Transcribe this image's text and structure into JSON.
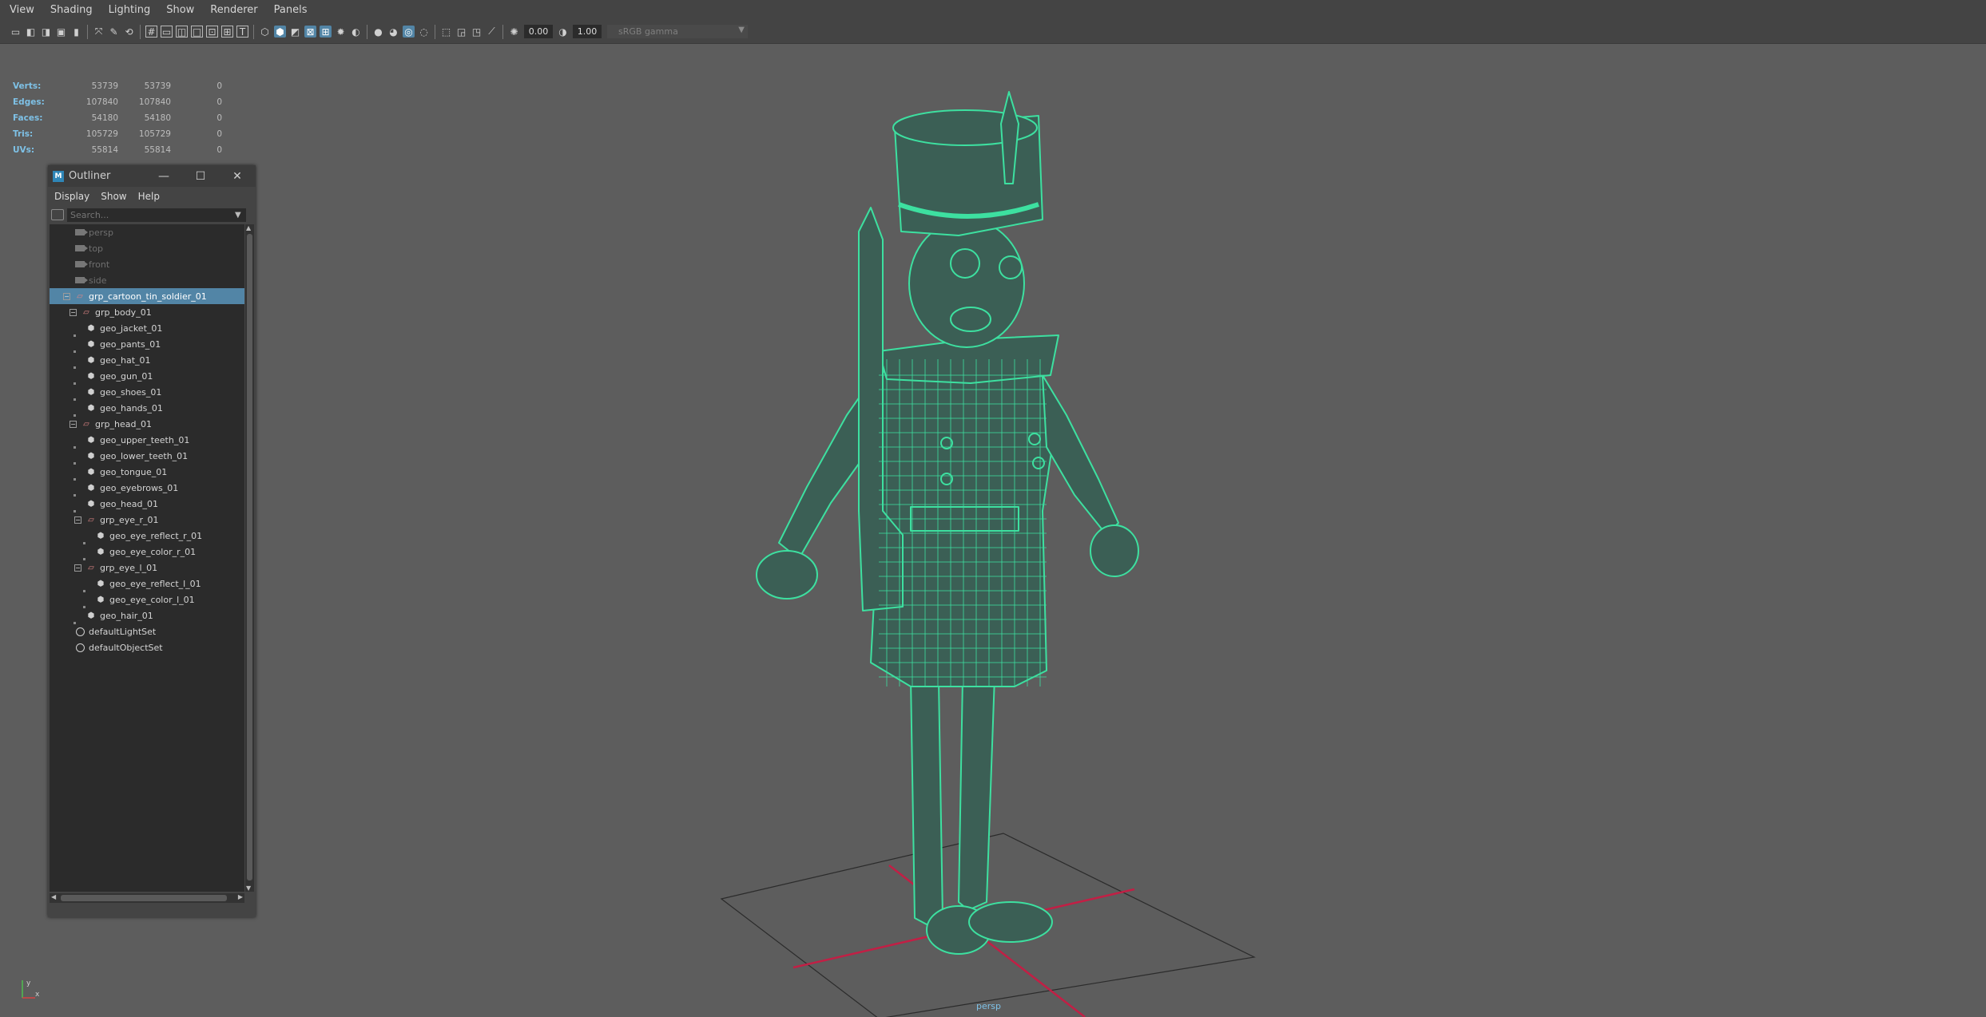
{
  "menubar": [
    "View",
    "Shading",
    "Lighting",
    "Show",
    "Renderer",
    "Panels"
  ],
  "toolbar": {
    "exposure": "0.00",
    "gamma": "1.00",
    "color_space": "sRGB gamma"
  },
  "hud": [
    {
      "label": "Verts:",
      "v1": "53739",
      "v2": "53739",
      "v3": "0"
    },
    {
      "label": "Edges:",
      "v1": "107840",
      "v2": "107840",
      "v3": "0"
    },
    {
      "label": "Faces:",
      "v1": "54180",
      "v2": "54180",
      "v3": "0"
    },
    {
      "label": "Tris:",
      "v1": "105729",
      "v2": "105729",
      "v3": "0"
    },
    {
      "label": "UVs:",
      "v1": "55814",
      "v2": "55814",
      "v3": "0"
    }
  ],
  "camera_label": "persp",
  "axis": {
    "x": "x",
    "y": "y"
  },
  "colors": {
    "wireframe": "#3de0a0",
    "selection": "#5285a6",
    "hud_label": "#7ec1e6",
    "grid_axis": "#c21f45"
  },
  "outliner": {
    "title": "Outliner",
    "menu": [
      "Display",
      "Show",
      "Help"
    ],
    "search_placeholder": "Search...",
    "items": [
      {
        "name": "persp",
        "icon": "camera-icon",
        "depth": 0,
        "dim": true
      },
      {
        "name": "top",
        "icon": "camera-icon",
        "depth": 0,
        "dim": true
      },
      {
        "name": "front",
        "icon": "camera-icon",
        "depth": 0,
        "dim": true
      },
      {
        "name": "side",
        "icon": "camera-icon",
        "depth": 0,
        "dim": true
      },
      {
        "name": "grp_cartoon_tin_soldier_01",
        "icon": "group-icon",
        "depth": 0,
        "expand": "−",
        "selected": true
      },
      {
        "name": "grp_body_01",
        "icon": "group-icon",
        "depth": 1,
        "expand": "−"
      },
      {
        "name": "geo_jacket_01",
        "icon": "mesh-icon",
        "depth": 2
      },
      {
        "name": "geo_pants_01",
        "icon": "mesh-icon",
        "depth": 2
      },
      {
        "name": "geo_hat_01",
        "icon": "mesh-icon",
        "depth": 2
      },
      {
        "name": "geo_gun_01",
        "icon": "mesh-icon",
        "depth": 2
      },
      {
        "name": "geo_shoes_01",
        "icon": "mesh-icon",
        "depth": 2
      },
      {
        "name": "geo_hands_01",
        "icon": "mesh-icon",
        "depth": 2
      },
      {
        "name": "grp_head_01",
        "icon": "group-icon",
        "depth": 1,
        "expand": "−"
      },
      {
        "name": "geo_upper_teeth_01",
        "icon": "mesh-icon",
        "depth": 2
      },
      {
        "name": "geo_lower_teeth_01",
        "icon": "mesh-icon",
        "depth": 2
      },
      {
        "name": "geo_tongue_01",
        "icon": "mesh-icon",
        "depth": 2
      },
      {
        "name": "geo_eyebrows_01",
        "icon": "mesh-icon",
        "depth": 2
      },
      {
        "name": "geo_head_01",
        "icon": "mesh-icon",
        "depth": 2
      },
      {
        "name": "grp_eye_r_01",
        "icon": "group-icon",
        "depth": 2,
        "expand": "−"
      },
      {
        "name": "geo_eye_reflect_r_01",
        "icon": "mesh-icon",
        "depth": 3
      },
      {
        "name": "geo_eye_color_r_01",
        "icon": "mesh-icon",
        "depth": 3
      },
      {
        "name": "grp_eye_l_01",
        "icon": "group-icon",
        "depth": 2,
        "expand": "−"
      },
      {
        "name": "geo_eye_reflect_l_01",
        "icon": "mesh-icon",
        "depth": 3
      },
      {
        "name": "geo_eye_color_l_01",
        "icon": "mesh-icon",
        "depth": 3
      },
      {
        "name": "geo_hair_01",
        "icon": "mesh-icon",
        "depth": 2
      },
      {
        "name": "defaultLightSet",
        "icon": "set-icon",
        "depth": 0
      },
      {
        "name": "defaultObjectSet",
        "icon": "set-icon",
        "depth": 0
      }
    ]
  }
}
